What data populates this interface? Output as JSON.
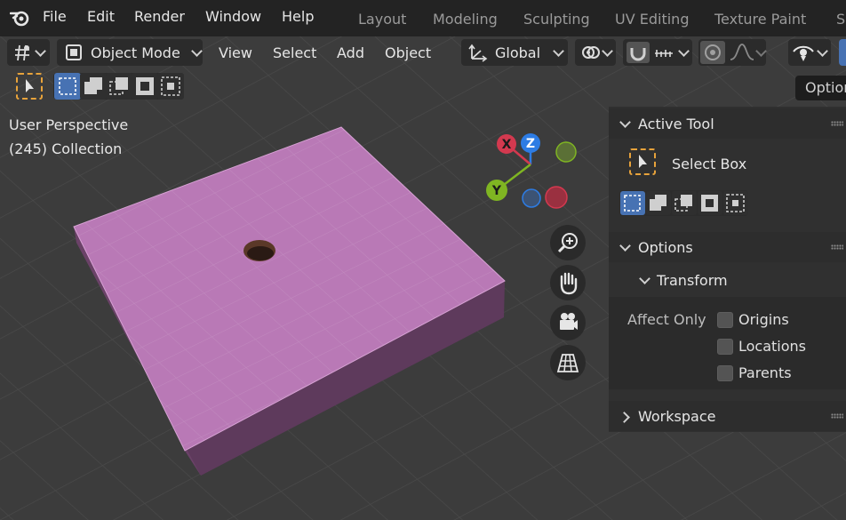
{
  "menubar": {
    "logo_icon": "blender-logo-icon",
    "items": [
      "File",
      "Edit",
      "Render",
      "Window",
      "Help"
    ],
    "workspace_tabs": [
      "Layout",
      "Modeling",
      "Sculpting",
      "UV Editing",
      "Texture Paint"
    ],
    "overflow_tab": "Sh"
  },
  "header": {
    "editor_type_icon": "viewport-editor-icon",
    "mode_label": "Object Mode",
    "menus": [
      "View",
      "Select",
      "Add",
      "Object"
    ],
    "orientation_label": "Global",
    "pivot_icon": "pivot-icon",
    "snap_icon": "magnet-snap-icon",
    "snap_target_icon": "snap-increment-icon",
    "proportional_icon": "proportional-edit-icon",
    "falloff_icon": "falloff-curve-icon",
    "visibility_icon": "eye-icon"
  },
  "viewport": {
    "view_name": "User Perspective",
    "collection": "(245) Collection",
    "gizmo_axes": {
      "x": "X",
      "y": "Y",
      "z": "Z"
    },
    "options_tab": "Options"
  },
  "npanel": {
    "active_tool_title": "Active Tool",
    "tool_name": "Select Box",
    "options_title": "Options",
    "transform_title": "Transform",
    "affect_only_label": "Affect Only",
    "checkboxes": [
      {
        "label": "Origins",
        "checked": false
      },
      {
        "label": "Locations",
        "checked": false
      },
      {
        "label": "Parents",
        "checked": false
      }
    ],
    "workspace_title": "Workspace"
  },
  "colors": {
    "object_face": "#b979b6",
    "accent_blue": "#4772b3",
    "axis_x": "#d3394f",
    "axis_y": "#7fb522",
    "axis_z": "#2d7ce4"
  }
}
